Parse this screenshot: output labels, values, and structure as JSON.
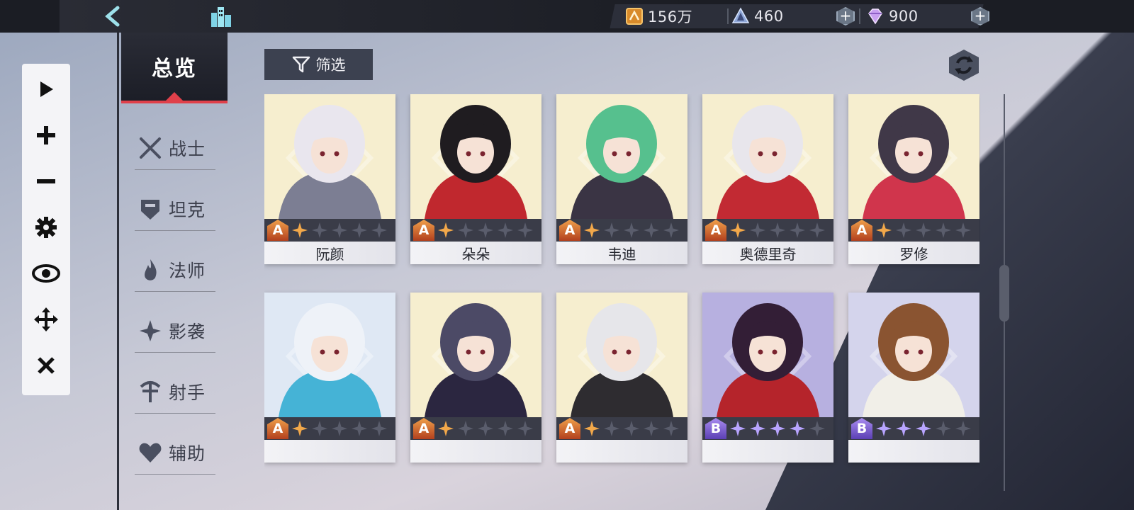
{
  "topbar": {
    "back_icon": "back-chevron-icon",
    "home_icon": "city-icon",
    "currencies": [
      {
        "icon": "gold-coin-icon",
        "value": "156万"
      },
      {
        "icon": "crystal-icon",
        "value": "460"
      },
      {
        "icon": "diamond-icon",
        "value": "900"
      }
    ]
  },
  "toolbar": {
    "tools": [
      "play-icon",
      "plus-icon",
      "minus-icon",
      "gear-icon",
      "eye-icon",
      "move-icon",
      "close-icon"
    ]
  },
  "nav": {
    "overview": "总览",
    "items": [
      {
        "label": "战士",
        "icon": "crossed-swords-icon"
      },
      {
        "label": "坦克",
        "icon": "helmet-icon"
      },
      {
        "label": "法师",
        "icon": "flame-icon"
      },
      {
        "label": "影袭",
        "icon": "shuriken-icon"
      },
      {
        "label": "射手",
        "icon": "bow-icon"
      },
      {
        "label": "辅助",
        "icon": "heart-icon"
      }
    ]
  },
  "filter": {
    "label": "筛选",
    "icon": "funnel-icon"
  },
  "refresh_icon": "refresh-icon",
  "colors": {
    "rank_a": "#e07a34",
    "rank_b": "#7b5cd6",
    "accent_red": "#e0404a",
    "star_gold": "#f2a84a",
    "star_violet": "#b8a4ff"
  },
  "heroes": [
    {
      "name": "阮颜",
      "rank": "A",
      "stars": 1,
      "palette": [
        "#f6eecf",
        "#e9e6ee",
        "#7c7e93"
      ]
    },
    {
      "name": "朵朵",
      "rank": "A",
      "stars": 1,
      "palette": [
        "#f6eecf",
        "#1f1c20",
        "#c0282e"
      ]
    },
    {
      "name": "韦迪",
      "rank": "A",
      "stars": 1,
      "palette": [
        "#f6eecf",
        "#56c08e",
        "#3a3444"
      ]
    },
    {
      "name": "奥德里奇",
      "rank": "A",
      "stars": 1,
      "palette": [
        "#f6eecf",
        "#e8e6ec",
        "#c22a33"
      ]
    },
    {
      "name": "罗修",
      "rank": "A",
      "stars": 1,
      "palette": [
        "#f6eecf",
        "#403848",
        "#d0354c"
      ]
    },
    {
      "name": "",
      "rank": "A",
      "stars": 1,
      "palette": [
        "#dfe8f4",
        "#eef2f8",
        "#45b3d6"
      ]
    },
    {
      "name": "",
      "rank": "A",
      "stars": 1,
      "palette": [
        "#f6eecf",
        "#4c4a66",
        "#2b2640"
      ]
    },
    {
      "name": "",
      "rank": "A",
      "stars": 1,
      "palette": [
        "#f6eecf",
        "#e6e6ea",
        "#2e2c30"
      ]
    },
    {
      "name": "",
      "rank": "B",
      "stars": 4,
      "palette": [
        "#b7b0e0",
        "#331e36",
        "#b5242b"
      ]
    },
    {
      "name": "",
      "rank": "B",
      "stars": 3,
      "palette": [
        "#d4d4ec",
        "#8a5431",
        "#f1efe8"
      ]
    }
  ]
}
